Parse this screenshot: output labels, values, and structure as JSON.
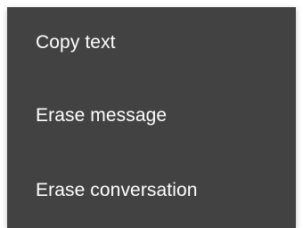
{
  "context_menu": {
    "items": [
      {
        "label": "Copy text"
      },
      {
        "label": "Erase message"
      },
      {
        "label": "Erase conversation"
      }
    ]
  },
  "colors": {
    "menu_background": "#424242",
    "text": "#ffffff"
  }
}
